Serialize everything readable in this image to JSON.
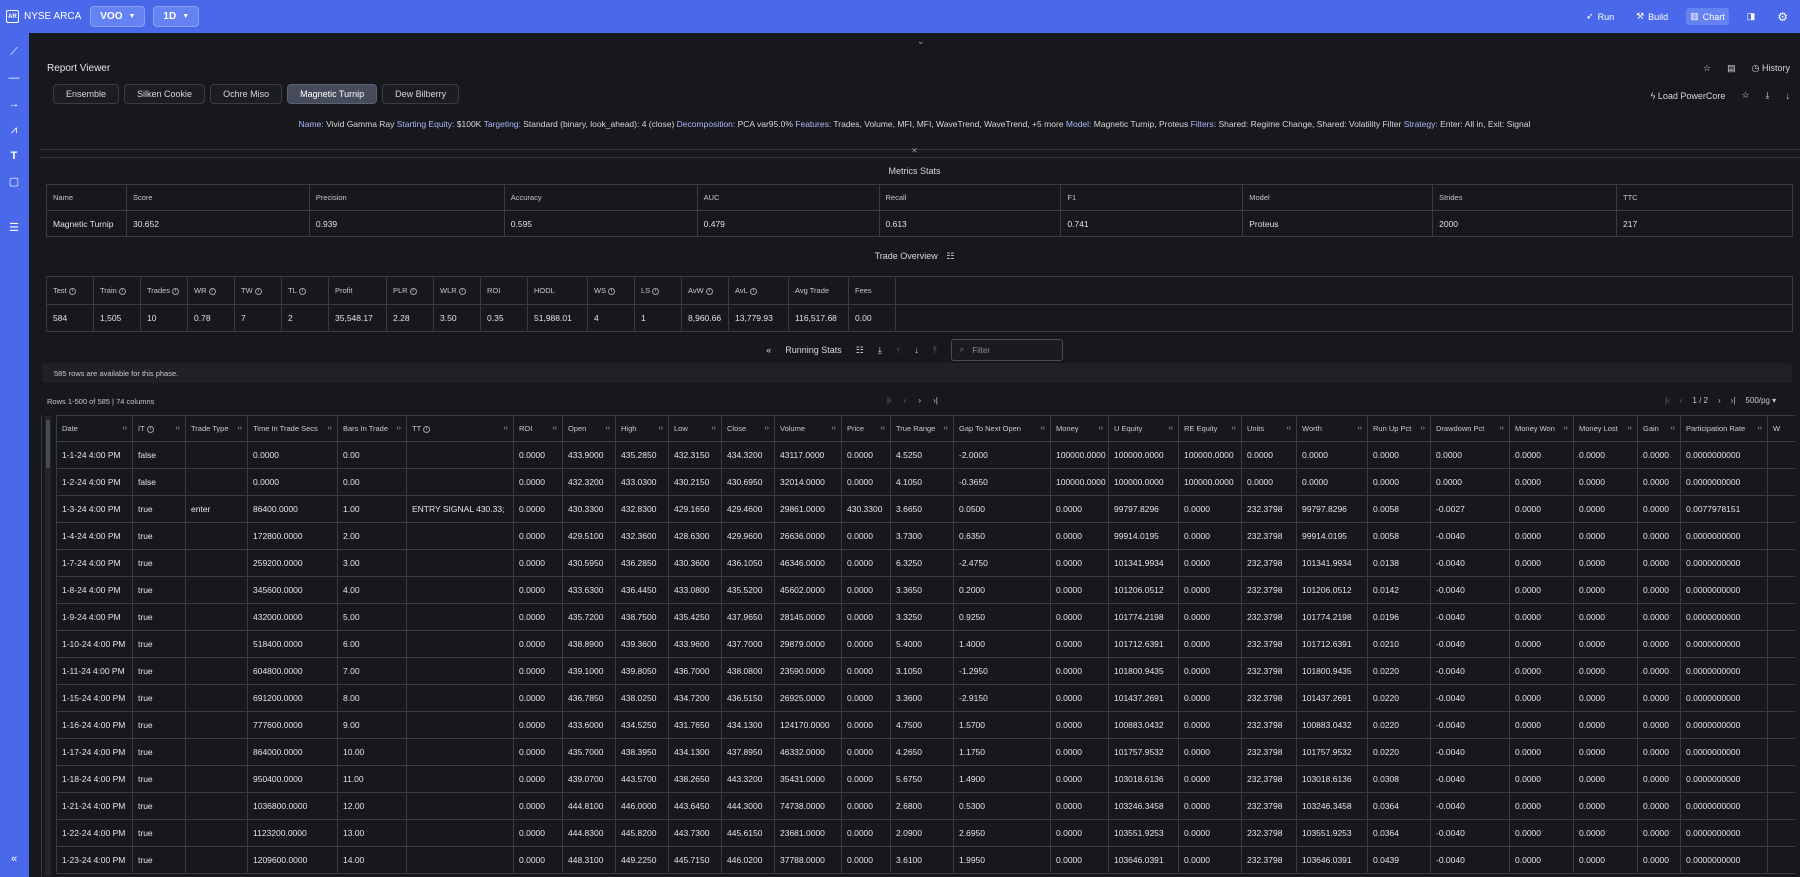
{
  "topbar": {
    "logo": "AR",
    "exchange": "NYSE ARCA",
    "symbol": "VOO",
    "interval": "1D",
    "run_label": "Run",
    "build_label": "Build",
    "chart_label": "Chart"
  },
  "report": {
    "title": "Report Viewer",
    "history_label": "History",
    "load_label": "Load PowerCore",
    "tabs": [
      "Ensemble",
      "Silken Cookie",
      "Ochre Miso",
      "Magnetic Turnip",
      "Dew Bilberry"
    ],
    "active_tab": 3
  },
  "summary": [
    {
      "k": "Name:",
      "v": "Vivid Gamma Ray"
    },
    {
      "k": "Starting Equity:",
      "v": "$100K"
    },
    {
      "k": "Targeting:",
      "v": "Standard (binary, look_ahead): 4 (close)"
    },
    {
      "k": "Decomposition:",
      "v": "PCA var95.0%"
    },
    {
      "k": "Features:",
      "v": "Trades, Volume, MFI, MFI, WaveTrend, WaveTrend, +5 more"
    },
    {
      "k": "Model:",
      "v": "Magnetic Turnip, Proteus"
    },
    {
      "k": "Filters:",
      "v": "Shared: Regime Change, Shared: Volatility Filter"
    },
    {
      "k": "Strategy:",
      "v": "Enter: All in, Exit: Signal"
    }
  ],
  "metrics": {
    "title": "Metrics Stats",
    "headers": [
      "Name",
      "Score",
      "Precision",
      "Accuracy",
      "AUC",
      "Recall",
      "F1",
      "Model",
      "Strides",
      "TTC"
    ],
    "values": [
      "Magnetic Turnip",
      "30.652",
      "0.939",
      "0.595",
      "0.479",
      "0.613",
      "0.741",
      "Proteus",
      "2000",
      "217"
    ]
  },
  "trade_overview": {
    "title": "Trade Overview",
    "headers": [
      "Test",
      "Train",
      "Trades",
      "WR",
      "TW",
      "TL",
      "Profit",
      "PLR",
      "WLR",
      "ROI",
      "HODL",
      "WS",
      "LS",
      "AvW",
      "AvL",
      "Avg Trade",
      "Fees"
    ],
    "info": [
      true,
      true,
      true,
      true,
      true,
      true,
      false,
      true,
      true,
      false,
      false,
      true,
      true,
      true,
      true,
      false,
      false
    ],
    "values": [
      "584",
      "1,505",
      "10",
      "0.78",
      "7",
      "2",
      "35,548.17",
      "2.28",
      "3.50",
      "0.35",
      "51,988.01",
      "4",
      "1",
      "8,960.66",
      "13,779.93",
      "116,517.68",
      "0.00"
    ]
  },
  "running": {
    "label": "Running Stats",
    "filter_placeholder": "Filter",
    "notice": "585 rows are available for this phase.",
    "rows_info": "Rows 1-500 of 585 | 74 columns",
    "page": "1 / 2",
    "per_page": "500/pg"
  },
  "columns": [
    "Date",
    "IT",
    "Trade Type",
    "Time In Trade Secs",
    "Bars In Trade",
    "TT",
    "ROI",
    "Open",
    "High",
    "Low",
    "Close",
    "Volume",
    "Price",
    "True Range",
    "Gap To Next Open",
    "Money",
    "U Equity",
    "RE Equity",
    "Units",
    "Worth",
    "Run Up Pct",
    "Drawdown Pct",
    "Money Won",
    "Money Lost",
    "Gain",
    "Participation Rate",
    "W"
  ],
  "col_info": [
    false,
    true,
    false,
    false,
    false,
    true,
    false,
    false,
    false,
    false,
    false,
    false,
    false,
    false,
    false,
    false,
    false,
    false,
    false,
    false,
    false,
    false,
    false,
    false,
    false,
    false,
    false
  ],
  "rows": [
    [
      "1-1-24 4:00 PM",
      "false",
      "",
      "0.0000",
      "0.00",
      "",
      "0.0000",
      "433.9000",
      "435.2850",
      "432.3150",
      "434.3200",
      "43117.0000",
      "0.0000",
      "4.5250",
      "-2.0000",
      "100000.0000",
      "100000.0000",
      "100000.0000",
      "0.0000",
      "0.0000",
      "0.0000",
      "0.0000",
      "0.0000",
      "0.0000",
      "0.0000",
      "0.0000000000",
      ""
    ],
    [
      "1-2-24 4:00 PM",
      "false",
      "",
      "0.0000",
      "0.00",
      "",
      "0.0000",
      "432.3200",
      "433.0300",
      "430.2150",
      "430.6950",
      "32014.0000",
      "0.0000",
      "4.1050",
      "-0.3650",
      "100000.0000",
      "100000.0000",
      "100000.0000",
      "0.0000",
      "0.0000",
      "0.0000",
      "0.0000",
      "0.0000",
      "0.0000",
      "0.0000",
      "0.0000000000",
      ""
    ],
    [
      "1-3-24 4:00 PM",
      "true",
      "enter",
      "86400.0000",
      "1.00",
      "ENTRY SIGNAL 430.33;",
      "0.0000",
      "430.3300",
      "432.8300",
      "429.1650",
      "429.4600",
      "29861.0000",
      "430.3300",
      "3.6650",
      "0.0500",
      "0.0000",
      "99797.8296",
      "0.0000",
      "232.3798",
      "99797.8296",
      "0.0058",
      "-0.0027",
      "0.0000",
      "0.0000",
      "0.0000",
      "0.0077978151",
      ""
    ],
    [
      "1-4-24 4:00 PM",
      "true",
      "",
      "172800.0000",
      "2.00",
      "",
      "0.0000",
      "429.5100",
      "432.3600",
      "428.6300",
      "429.9600",
      "26636.0000",
      "0.0000",
      "3.7300",
      "0.6350",
      "0.0000",
      "99914.0195",
      "0.0000",
      "232.3798",
      "99914.0195",
      "0.0058",
      "-0.0040",
      "0.0000",
      "0.0000",
      "0.0000",
      "0.0000000000",
      ""
    ],
    [
      "1-7-24 4:00 PM",
      "true",
      "",
      "259200.0000",
      "3.00",
      "",
      "0.0000",
      "430.5950",
      "436.2850",
      "430.3600",
      "436.1050",
      "46346.0000",
      "0.0000",
      "6.3250",
      "-2.4750",
      "0.0000",
      "101341.9934",
      "0.0000",
      "232.3798",
      "101341.9934",
      "0.0138",
      "-0.0040",
      "0.0000",
      "0.0000",
      "0.0000",
      "0.0000000000",
      ""
    ],
    [
      "1-8-24 4:00 PM",
      "true",
      "",
      "345600.0000",
      "4.00",
      "",
      "0.0000",
      "433.6300",
      "436.4450",
      "433.0800",
      "435.5200",
      "45602.0000",
      "0.0000",
      "3.3650",
      "0.2000",
      "0.0000",
      "101206.0512",
      "0.0000",
      "232.3798",
      "101206.0512",
      "0.0142",
      "-0.0040",
      "0.0000",
      "0.0000",
      "0.0000",
      "0.0000000000",
      ""
    ],
    [
      "1-9-24 4:00 PM",
      "true",
      "",
      "432000.0000",
      "5.00",
      "",
      "0.0000",
      "435.7200",
      "438.7500",
      "435.4250",
      "437.9650",
      "28145.0000",
      "0.0000",
      "3.3250",
      "0.9250",
      "0.0000",
      "101774.2198",
      "0.0000",
      "232.3798",
      "101774.2198",
      "0.0196",
      "-0.0040",
      "0.0000",
      "0.0000",
      "0.0000",
      "0.0000000000",
      ""
    ],
    [
      "1-10-24 4:00 PM",
      "true",
      "",
      "518400.0000",
      "6.00",
      "",
      "0.0000",
      "438.8900",
      "439.3600",
      "433.9600",
      "437.7000",
      "29879.0000",
      "0.0000",
      "5.4000",
      "1.4000",
      "0.0000",
      "101712.6391",
      "0.0000",
      "232.3798",
      "101712.6391",
      "0.0210",
      "-0.0040",
      "0.0000",
      "0.0000",
      "0.0000",
      "0.0000000000",
      ""
    ],
    [
      "1-11-24 4:00 PM",
      "true",
      "",
      "604800.0000",
      "7.00",
      "",
      "0.0000",
      "439.1000",
      "439.8050",
      "436.7000",
      "438.0800",
      "23590.0000",
      "0.0000",
      "3.1050",
      "-1.2950",
      "0.0000",
      "101800.9435",
      "0.0000",
      "232.3798",
      "101800.9435",
      "0.0220",
      "-0.0040",
      "0.0000",
      "0.0000",
      "0.0000",
      "0.0000000000",
      ""
    ],
    [
      "1-15-24 4:00 PM",
      "true",
      "",
      "691200.0000",
      "8.00",
      "",
      "0.0000",
      "436.7850",
      "438.0250",
      "434.7200",
      "436.5150",
      "26925.0000",
      "0.0000",
      "3.3600",
      "-2.9150",
      "0.0000",
      "101437.2691",
      "0.0000",
      "232.3798",
      "101437.2691",
      "0.0220",
      "-0.0040",
      "0.0000",
      "0.0000",
      "0.0000",
      "0.0000000000",
      ""
    ],
    [
      "1-16-24 4:00 PM",
      "true",
      "",
      "777600.0000",
      "9.00",
      "",
      "0.0000",
      "433.6000",
      "434.5250",
      "431.7650",
      "434.1300",
      "124170.0000",
      "0.0000",
      "4.7500",
      "1.5700",
      "0.0000",
      "100883.0432",
      "0.0000",
      "232.3798",
      "100883.0432",
      "0.0220",
      "-0.0040",
      "0.0000",
      "0.0000",
      "0.0000",
      "0.0000000000",
      ""
    ],
    [
      "1-17-24 4:00 PM",
      "true",
      "",
      "864000.0000",
      "10.00",
      "",
      "0.0000",
      "435.7000",
      "438.3950",
      "434.1300",
      "437.8950",
      "46332.0000",
      "0.0000",
      "4.2650",
      "1.1750",
      "0.0000",
      "101757.9532",
      "0.0000",
      "232.3798",
      "101757.9532",
      "0.0220",
      "-0.0040",
      "0.0000",
      "0.0000",
      "0.0000",
      "0.0000000000",
      ""
    ],
    [
      "1-18-24 4:00 PM",
      "true",
      "",
      "950400.0000",
      "11.00",
      "",
      "0.0000",
      "439.0700",
      "443.5700",
      "438.2650",
      "443.3200",
      "35431.0000",
      "0.0000",
      "5.6750",
      "1.4900",
      "0.0000",
      "103018.6136",
      "0.0000",
      "232.3798",
      "103018.6136",
      "0.0308",
      "-0.0040",
      "0.0000",
      "0.0000",
      "0.0000",
      "0.0000000000",
      ""
    ],
    [
      "1-21-24 4:00 PM",
      "true",
      "",
      "1036800.0000",
      "12.00",
      "",
      "0.0000",
      "444.8100",
      "446.0000",
      "443.6450",
      "444.3000",
      "74738.0000",
      "0.0000",
      "2.6800",
      "0.5300",
      "0.0000",
      "103246.3458",
      "0.0000",
      "232.3798",
      "103246.3458",
      "0.0364",
      "-0.0040",
      "0.0000",
      "0.0000",
      "0.0000",
      "0.0000000000",
      ""
    ],
    [
      "1-22-24 4:00 PM",
      "true",
      "",
      "1123200.0000",
      "13.00",
      "",
      "0.0000",
      "444.8300",
      "445.8200",
      "443.7300",
      "445.6150",
      "23681.0000",
      "0.0000",
      "2.0900",
      "2.6950",
      "0.0000",
      "103551.9253",
      "0.0000",
      "232.3798",
      "103551.9253",
      "0.0364",
      "-0.0040",
      "0.0000",
      "0.0000",
      "0.0000",
      "0.0000000000",
      ""
    ],
    [
      "1-23-24 4:00 PM",
      "true",
      "",
      "1209600.0000",
      "14.00",
      "",
      "0.0000",
      "448.3100",
      "449.2250",
      "445.7150",
      "446.0200",
      "37788.0000",
      "0.0000",
      "3.6100",
      "1.9950",
      "0.0000",
      "103646.0391",
      "0.0000",
      "232.3798",
      "103646.0391",
      "0.0439",
      "-0.0040",
      "0.0000",
      "0.0000",
      "0.0000",
      "0.0000000000",
      ""
    ]
  ]
}
